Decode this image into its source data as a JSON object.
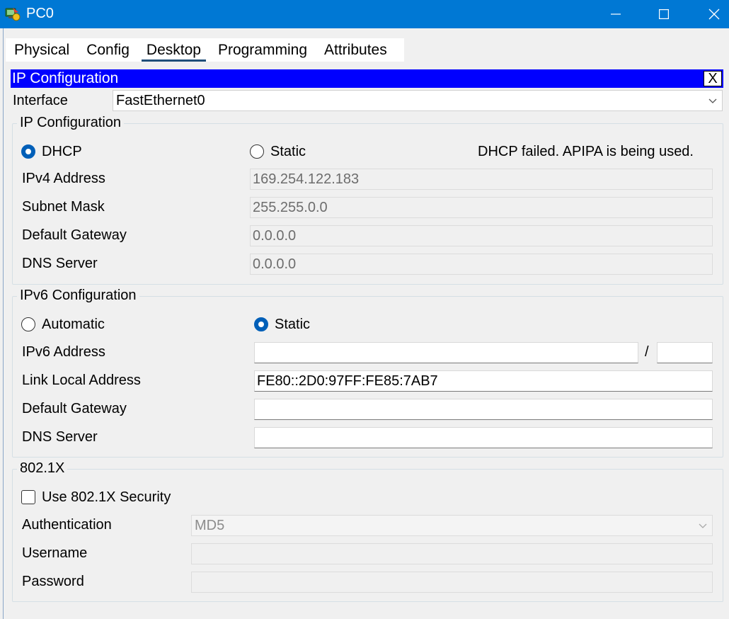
{
  "window": {
    "title": "PC0"
  },
  "tabs": [
    {
      "label": "Physical"
    },
    {
      "label": "Config"
    },
    {
      "label": "Desktop"
    },
    {
      "label": "Programming"
    },
    {
      "label": "Attributes"
    }
  ],
  "active_tab": "Desktop",
  "dialog": {
    "title": "IP Configuration",
    "close_label": "X"
  },
  "interface": {
    "label": "Interface",
    "value": "FastEthernet0"
  },
  "ipv4": {
    "group_title": "IP Configuration",
    "dhcp_label": "DHCP",
    "static_label": "Static",
    "mode": "DHCP",
    "status": "DHCP failed. APIPA is being used.",
    "address_label": "IPv4 Address",
    "address": "169.254.122.183",
    "mask_label": "Subnet Mask",
    "mask": "255.255.0.0",
    "gateway_label": "Default Gateway",
    "gateway": "0.0.0.0",
    "dns_label": "DNS Server",
    "dns": "0.0.0.0"
  },
  "ipv6": {
    "group_title": "IPv6 Configuration",
    "automatic_label": "Automatic",
    "static_label": "Static",
    "mode": "Static",
    "address_label": "IPv6 Address",
    "address": "",
    "prefix_separator": "/",
    "prefix": "",
    "link_local_label": "Link Local Address",
    "link_local": "FE80::2D0:97FF:FE85:7AB7",
    "gateway_label": "Default Gateway",
    "gateway": "",
    "dns_label": "DNS Server",
    "dns": ""
  },
  "dot1x": {
    "group_title": "802.1X",
    "use_security_label": "Use 802.1X Security",
    "use_security": false,
    "auth_label": "Authentication",
    "auth_value": "MD5",
    "username_label": "Username",
    "username": "",
    "password_label": "Password",
    "password": ""
  },
  "colors": {
    "titlebar": "#0078d4",
    "dialog_header": "#0000ff",
    "radio_selected": "#005fb8",
    "active_tab_underline": "#1f4e79"
  }
}
